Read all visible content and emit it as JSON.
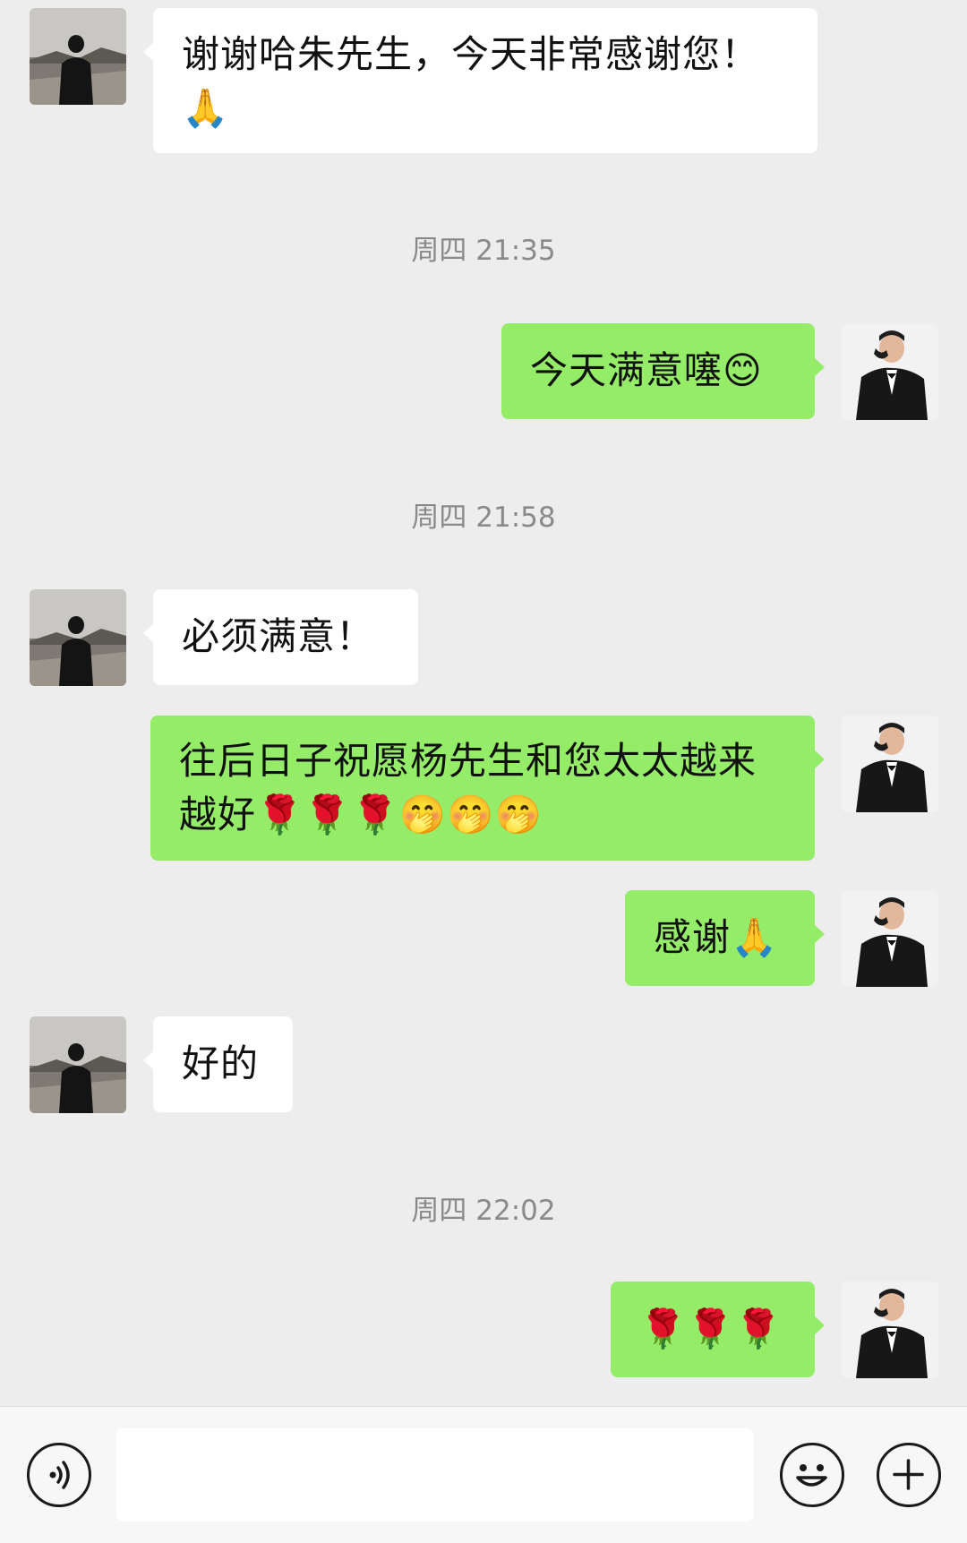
{
  "messages": [
    {
      "side": "in",
      "text": "谢谢哈朱先生，今天非常感谢您！\n🙏"
    },
    {
      "type": "time",
      "text": "周四 21:35"
    },
    {
      "side": "out",
      "text": "今天满意噻😊"
    },
    {
      "type": "time",
      "text": "周四 21:58"
    },
    {
      "side": "in",
      "text": "必须满意！"
    },
    {
      "side": "out",
      "text": "往后日子祝愿杨先生和您太太越来越好🌹🌹🌹🤭🤭🤭"
    },
    {
      "side": "out",
      "text": "感谢🙏"
    },
    {
      "side": "in",
      "text": "好的"
    },
    {
      "type": "time",
      "text": "周四 22:02"
    },
    {
      "side": "out",
      "text": "🌹🌹🌹"
    }
  ],
  "input": {
    "placeholder": ""
  },
  "icons": {
    "voice": "voice-icon",
    "emoji": "emoji-icon",
    "plus": "plus-icon"
  },
  "colors": {
    "outgoing_bubble": "#95ec69",
    "incoming_bubble": "#ffffff",
    "background": "#ededed"
  }
}
